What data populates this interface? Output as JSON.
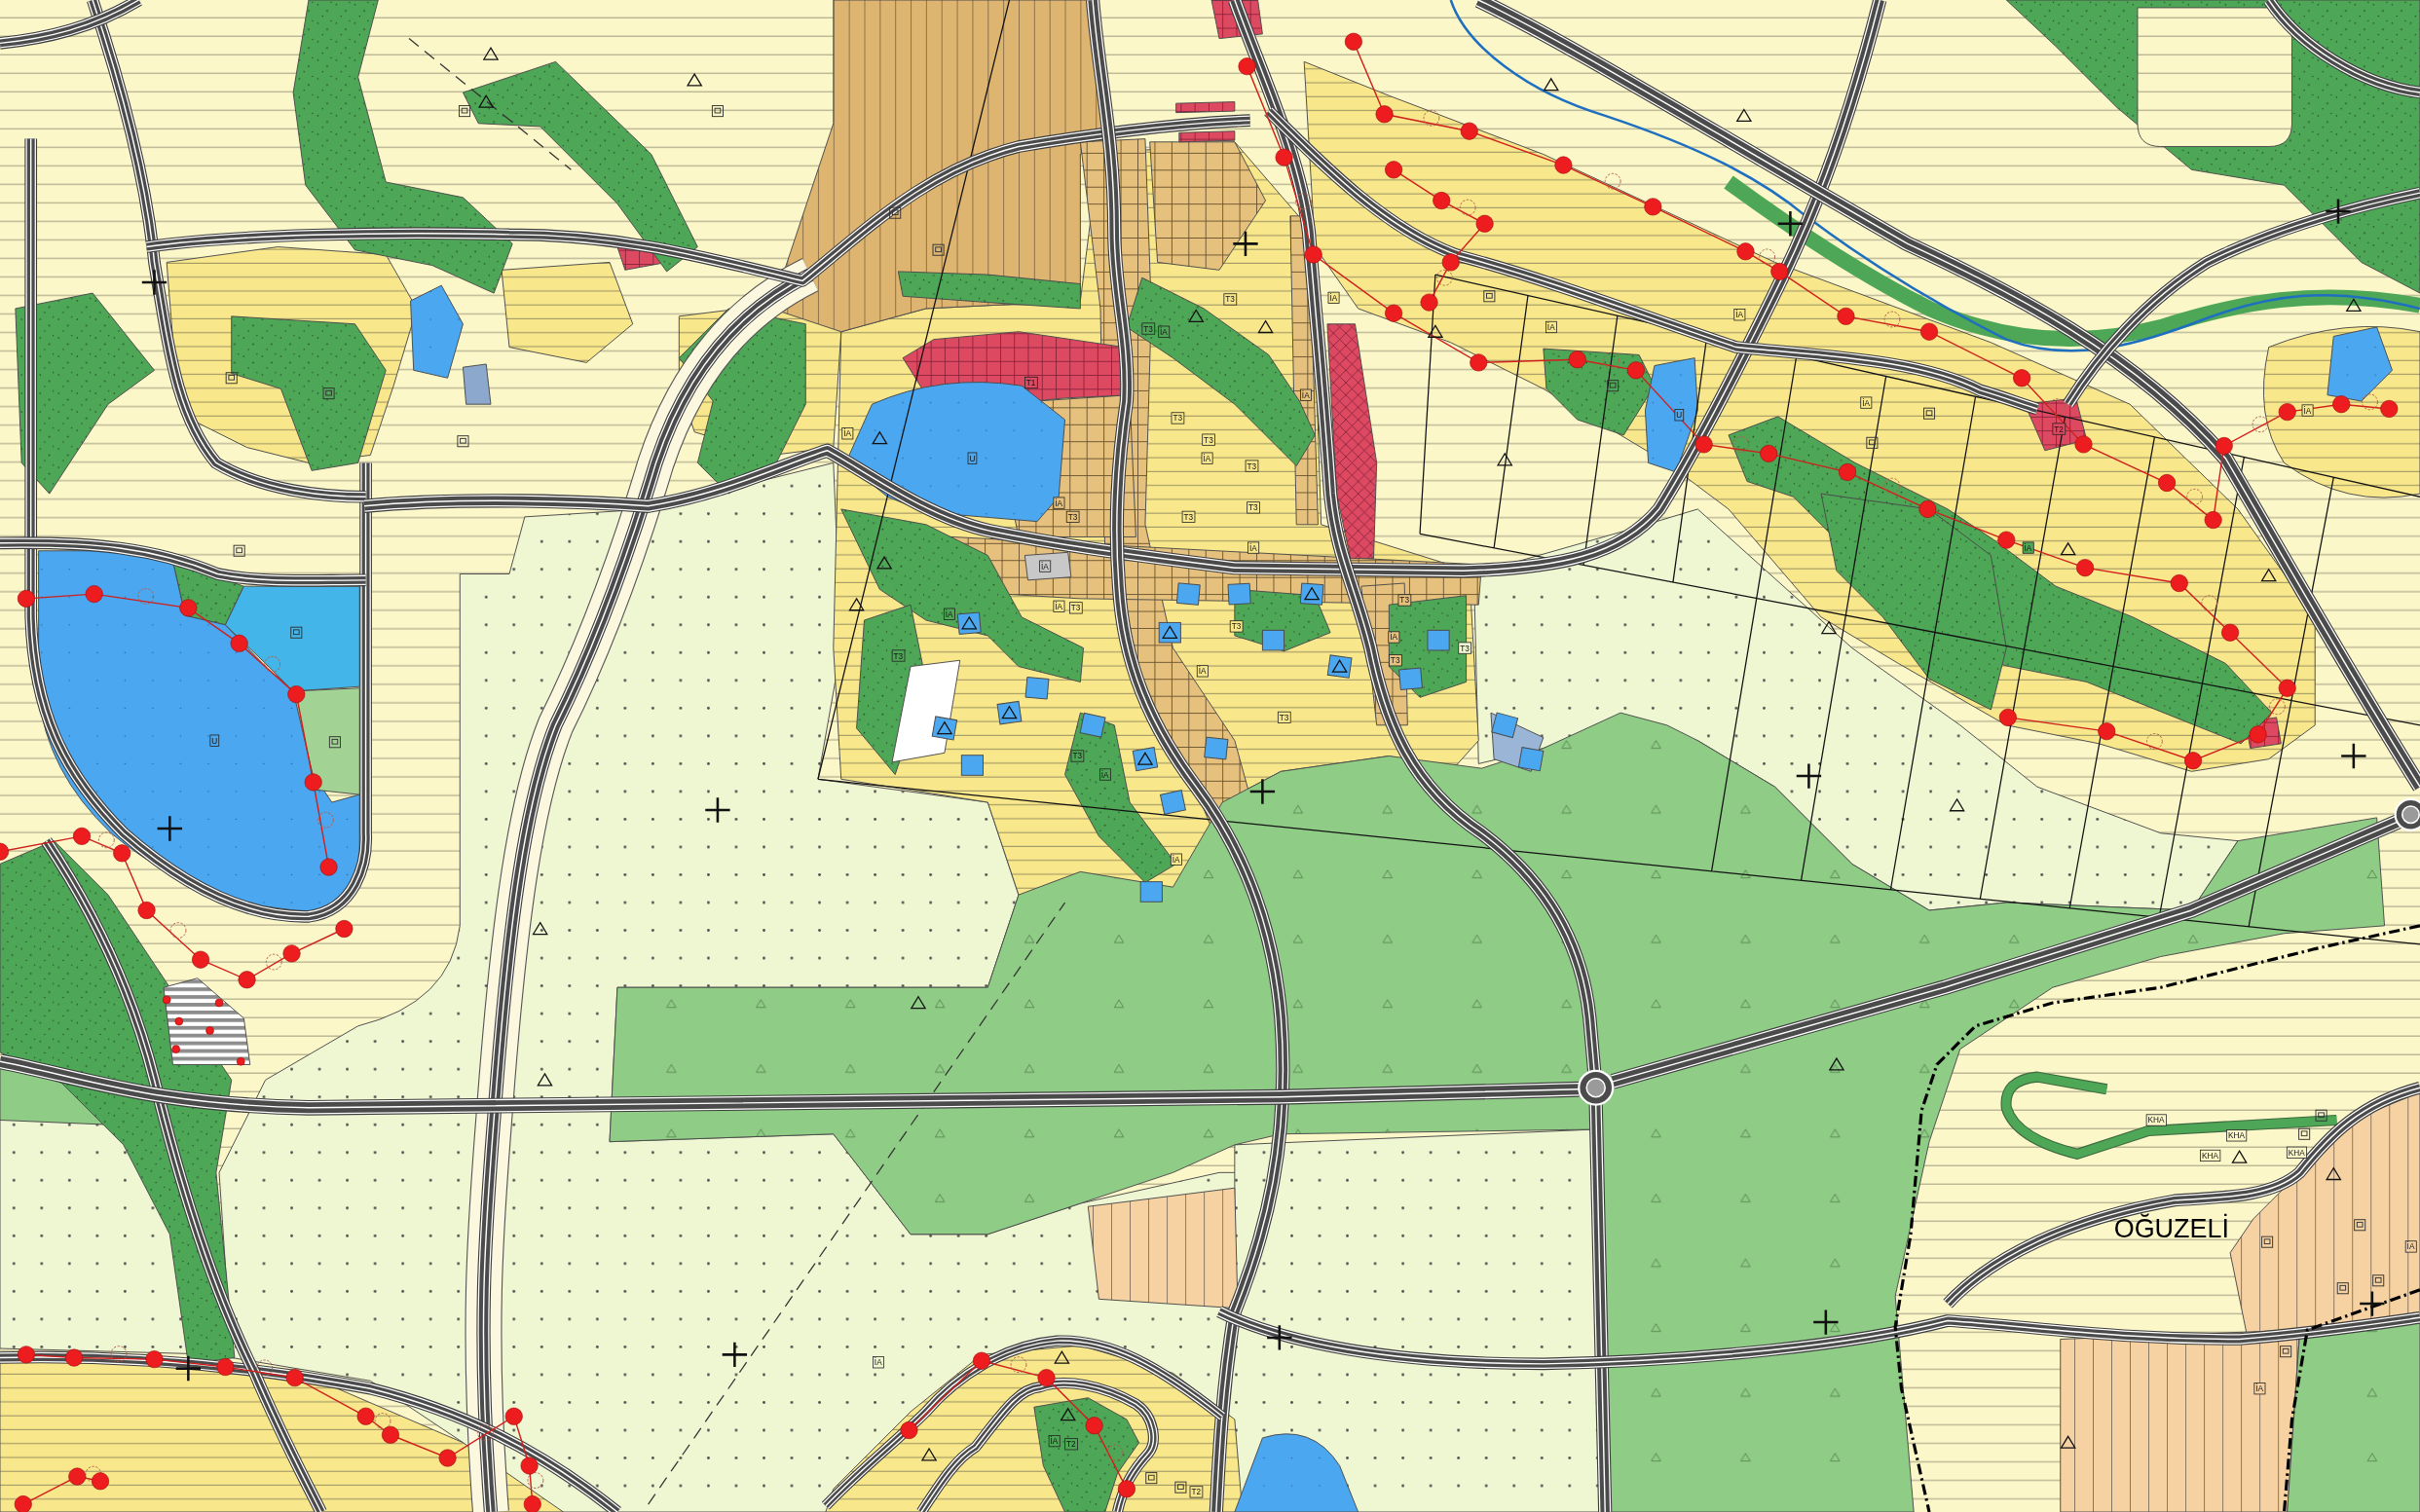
{
  "map": {
    "place_label": "OĞUZELİ",
    "symbol_labels": [
      "T1",
      "U",
      "İA",
      "T3",
      "T3",
      "İA",
      "T3",
      "T3",
      "T3",
      "İA",
      "İA",
      "İA",
      "İA",
      "İA",
      "T3",
      "T3",
      "İA",
      "İA",
      "İA",
      "T3",
      "T3",
      "T3",
      "T3",
      "İA",
      "T3",
      "İA",
      "T3",
      "T3",
      "İA",
      "İA",
      "İA",
      "İA",
      "U",
      "T2",
      "İA",
      "İA",
      "T3",
      "T3",
      "İA",
      "KHA",
      "KHA",
      "KHA",
      "KHA",
      "İA",
      "İA",
      "T2",
      "İA",
      "T2",
      "İA",
      "U"
    ]
  }
}
